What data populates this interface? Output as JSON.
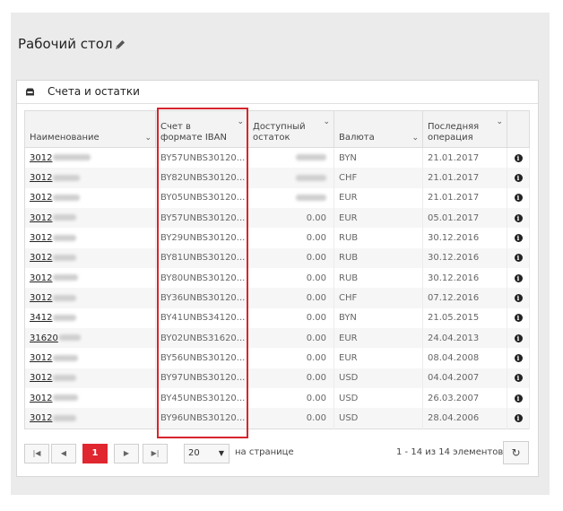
{
  "page": {
    "title": "Рабочий стол"
  },
  "panel": {
    "title": "Счета и остатки"
  },
  "columns": {
    "name": "Наименование",
    "iban_1": "Счет в",
    "iban_2": "формате IBAN",
    "balance_1": "Доступный",
    "balance_2": "остаток",
    "currency": "Валюта",
    "last_op_1": "Последняя",
    "last_op_2": "операция"
  },
  "rows": [
    {
      "name": "3012",
      "iban": "BY57UNBS30120...",
      "balance": "",
      "currency": "BYN",
      "date": "21.01.2017"
    },
    {
      "name": "3012",
      "iban": "BY82UNBS30120...",
      "balance": "",
      "currency": "CHF",
      "date": "21.01.2017"
    },
    {
      "name": "3012",
      "iban": "BY05UNBS30120...",
      "balance": "",
      "currency": "EUR",
      "date": "21.01.2017"
    },
    {
      "name": "3012",
      "iban": "BY57UNBS30120...",
      "balance": "0.00",
      "currency": "EUR",
      "date": "05.01.2017"
    },
    {
      "name": "3012",
      "iban": "BY29UNBS30120...",
      "balance": "0.00",
      "currency": "RUB",
      "date": "30.12.2016"
    },
    {
      "name": "3012",
      "iban": "BY81UNBS30120...",
      "balance": "0.00",
      "currency": "RUB",
      "date": "30.12.2016"
    },
    {
      "name": "3012",
      "iban": "BY80UNBS30120...",
      "balance": "0.00",
      "currency": "RUB",
      "date": "30.12.2016"
    },
    {
      "name": "3012",
      "iban": "BY36UNBS30120...",
      "balance": "0.00",
      "currency": "CHF",
      "date": "07.12.2016"
    },
    {
      "name": "3412",
      "iban": "BY41UNBS34120...",
      "balance": "0.00",
      "currency": "BYN",
      "date": "21.05.2015"
    },
    {
      "name": "31620",
      "iban": "BY02UNBS31620...",
      "balance": "0.00",
      "currency": "EUR",
      "date": "24.04.2013"
    },
    {
      "name": "3012",
      "iban": "BY56UNBS30120...",
      "balance": "0.00",
      "currency": "EUR",
      "date": "08.04.2008"
    },
    {
      "name": "3012",
      "iban": "BY97UNBS30120...",
      "balance": "0.00",
      "currency": "USD",
      "date": "04.04.2007"
    },
    {
      "name": "3012",
      "iban": "BY45UNBS30120...",
      "balance": "0.00",
      "currency": "USD",
      "date": "26.03.2007"
    },
    {
      "name": "3012",
      "iban": "BY96UNBS30120...",
      "balance": "0.00",
      "currency": "USD",
      "date": "28.04.2006"
    }
  ],
  "pager": {
    "first": "|◀",
    "prev": "◀",
    "current": "1",
    "next": "▶",
    "last": "▶|",
    "page_size": "20",
    "per_page_label": "на странице",
    "range_label": "1 - 14 из 14 элементов"
  },
  "icons": {
    "edit": "pencil-icon",
    "wallet": "wallet-icon",
    "info": "info-icon",
    "refresh": "refresh-icon",
    "sort": "chevron-down-icon"
  },
  "colors": {
    "accent": "#e0262f",
    "highlight": "#d6252d"
  }
}
